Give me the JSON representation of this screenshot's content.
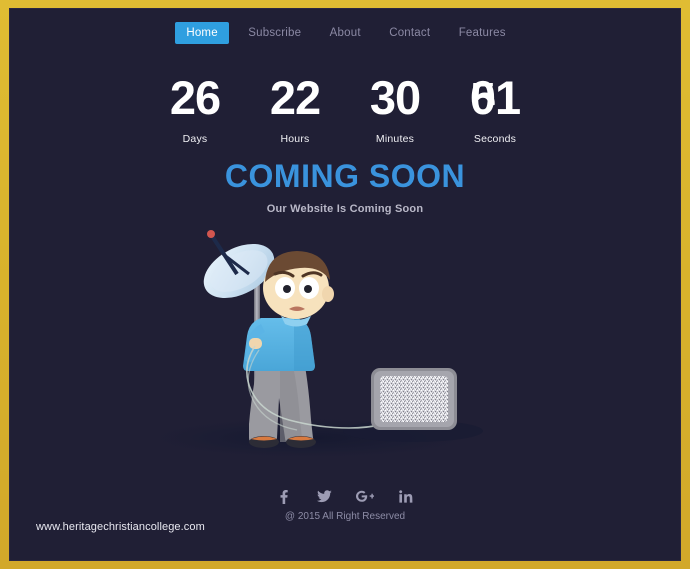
{
  "theme": {
    "frame_color": "#d8b22c",
    "page_background": "#201f35",
    "accent_blue": "#3a93dd",
    "active_nav_background": "#2f9fe0",
    "nav_text_color": "#8b89a4",
    "heading_color": "#3a93dd",
    "subtitle_color": "#b9b8c8"
  },
  "nav": {
    "items": [
      {
        "label": "Home",
        "active": true
      },
      {
        "label": "Subscribe",
        "active": false
      },
      {
        "label": "About",
        "active": false
      },
      {
        "label": "Contact",
        "active": false
      },
      {
        "label": "Features",
        "active": false
      }
    ]
  },
  "countdown": {
    "cells": [
      {
        "value": "26",
        "label": "Days"
      },
      {
        "value": "22",
        "label": "Hours"
      },
      {
        "value": "30",
        "label": "Minutes"
      },
      {
        "value": "01",
        "label": "Seconds",
        "flipping": true,
        "flip_ghost": "5"
      }
    ]
  },
  "hero": {
    "title": "COMING SOON",
    "subtitle": "Our Website Is Coming Soon"
  },
  "illustration": {
    "description": "boy-holding-satellite-dish-with-static-tv",
    "dish_color": "#cfe4f3",
    "shirt_color": "#5bb4e5",
    "trousers_color": "#9a9aa0",
    "hair_color": "#6b4a33",
    "skin_color": "#f5dfb8",
    "tv_screen": "static-noise",
    "tv_bezel_color": "#8d8d95"
  },
  "social": {
    "icons": [
      {
        "name": "facebook-icon",
        "glyph": "f"
      },
      {
        "name": "twitter-icon",
        "glyph": "ᴠ"
      },
      {
        "name": "google-plus-icon",
        "glyph": "g"
      },
      {
        "name": "linkedin-icon",
        "glyph": "in"
      }
    ]
  },
  "footer": {
    "copyright": "@ 2015 All Right Reserved",
    "watermark": "www.heritagechristiancollege.com"
  }
}
